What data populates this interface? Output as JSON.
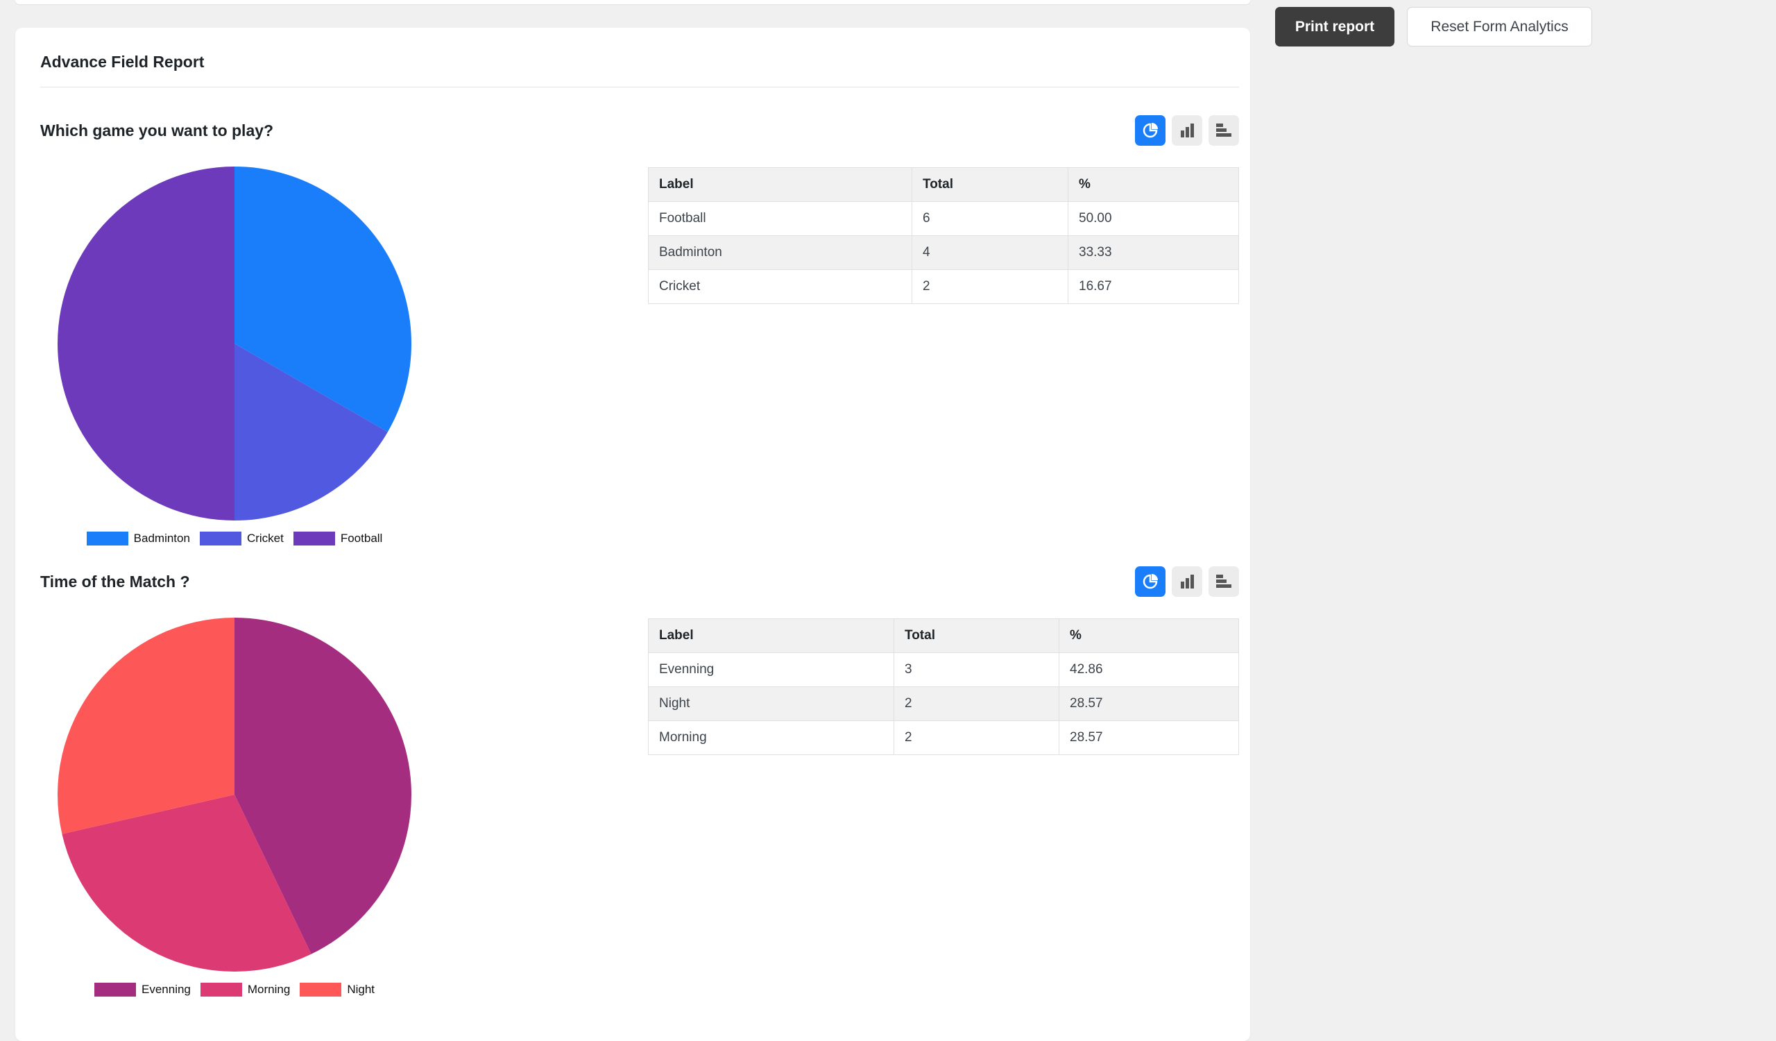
{
  "report": {
    "title": "Advance Field Report"
  },
  "actions": {
    "print_label": "Print report",
    "reset_label": "Reset Form Analytics"
  },
  "table_headers": [
    "Label",
    "Total",
    "%"
  ],
  "colors": {
    "active_switch": "#1a7efb",
    "q1": {
      "Badminton": "#1a7efb",
      "Cricket": "#5159e0",
      "Football": "#6c3aba"
    },
    "q2": {
      "Evenning": "#a52d7f",
      "Morning": "#dc3a72",
      "Night": "#fe5757"
    }
  },
  "questions": [
    {
      "title": "Which game you want to play?",
      "switcher": [
        "pie-chart-icon",
        "bar-chart-icon",
        "horizontal-bar-chart-icon"
      ],
      "legend": [
        "Badminton",
        "Cricket",
        "Football"
      ],
      "rows": [
        {
          "label": "Football",
          "total": "6",
          "percent": "50.00"
        },
        {
          "label": "Badminton",
          "total": "4",
          "percent": "33.33"
        },
        {
          "label": "Cricket",
          "total": "2",
          "percent": "16.67"
        }
      ]
    },
    {
      "title": "Time of the Match ?",
      "switcher": [
        "pie-chart-icon",
        "bar-chart-icon",
        "horizontal-bar-chart-icon"
      ],
      "legend": [
        "Evenning",
        "Morning",
        "Night"
      ],
      "rows": [
        {
          "label": "Evenning",
          "total": "3",
          "percent": "42.86"
        },
        {
          "label": "Night",
          "total": "2",
          "percent": "28.57"
        },
        {
          "label": "Morning",
          "total": "2",
          "percent": "28.57"
        }
      ]
    }
  ],
  "chart_data": [
    {
      "type": "pie",
      "categories": [
        "Badminton",
        "Cricket",
        "Football"
      ],
      "values": [
        4,
        2,
        6
      ]
    },
    {
      "type": "pie",
      "categories": [
        "Evenning",
        "Morning",
        "Night"
      ],
      "values": [
        3,
        2,
        2
      ]
    }
  ]
}
